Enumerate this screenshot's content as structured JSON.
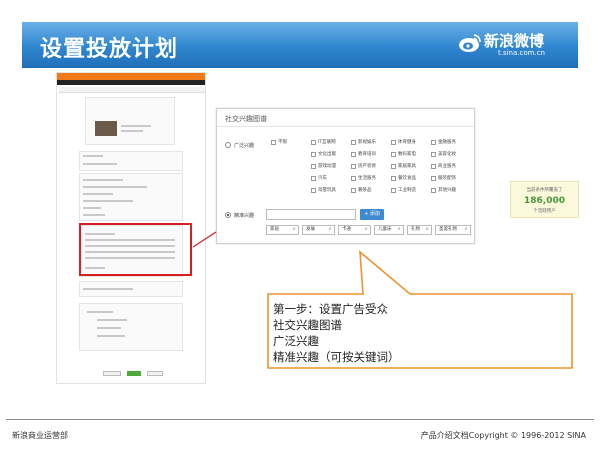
{
  "slide": {
    "title": "设置投放计划",
    "logo": {
      "name": "新浪微博",
      "domain": "t.sina.com.cn"
    }
  },
  "panel": {
    "title": "社交兴趣图谱",
    "broad_option": "广泛兴趣",
    "precise_option": "精准兴趣",
    "add_button": "+ 添加",
    "categories": [
      [
        "不限",
        "IT互联网",
        "影视娱乐",
        "体育健身",
        "金融服务"
      ],
      [
        "",
        "文化出版",
        "教育培训",
        "数码家电",
        "美容化妆"
      ],
      [
        "",
        "游戏动漫",
        "房产装修",
        "家居家具",
        "商业服务"
      ],
      [
        "",
        "汽车",
        "生活服务",
        "餐饮食品",
        "服装配饰"
      ],
      [
        "",
        "母婴玩具",
        "奢侈品",
        "工业制造",
        "其他兴趣"
      ]
    ],
    "tags": [
      "家居",
      "发展",
      "卡通",
      "儿童床",
      "礼物",
      "圣诞礼物"
    ]
  },
  "stats": {
    "caption": "当前条件所覆盖了",
    "number": "186,000",
    "unit": "个活跃用户"
  },
  "callout": {
    "lines": [
      "第一步：设置广告受众",
      "社交兴趣图谱",
      "广泛兴趣",
      "精准兴趣（可按关键词）"
    ]
  },
  "footer": {
    "left": "新浪商业运营部",
    "right": "产品介绍文档Copyright © 1996-2012 SINA"
  },
  "colors": {
    "header_blue": "#2f86cf",
    "highlight_red": "#d81e1e",
    "callout_orange": "#f0922c",
    "stats_green": "#47983a",
    "button_blue": "#3d8ad1"
  }
}
